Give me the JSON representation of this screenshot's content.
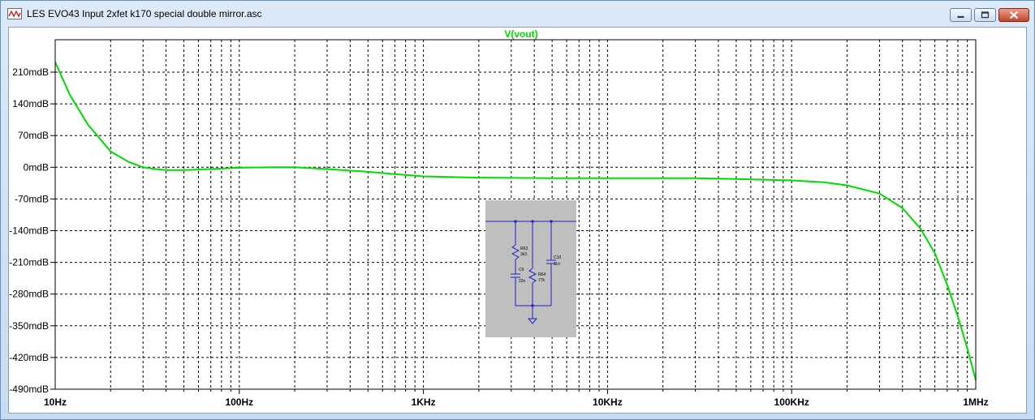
{
  "window": {
    "title": "LES EVO43 Input 2xfet k170 special double mirror.asc",
    "icon": "ltspice-waveform-icon",
    "controls": [
      "minimize-icon",
      "maximize-icon",
      "close-icon"
    ]
  },
  "chart_data": {
    "type": "line",
    "title": "V(vout)",
    "xlabel": "",
    "ylabel": "",
    "x_scale": "log",
    "xlim": [
      10,
      1000000
    ],
    "ylim": [
      -490,
      210
    ],
    "grid": true,
    "x_ticks": [
      {
        "value": 10,
        "label": "10Hz"
      },
      {
        "value": 100,
        "label": "100Hz"
      },
      {
        "value": 1000,
        "label": "1KHz"
      },
      {
        "value": 10000,
        "label": "10KHz"
      },
      {
        "value": 100000,
        "label": "100KHz"
      },
      {
        "value": 1000000,
        "label": "1MHz"
      }
    ],
    "y_ticks": [
      {
        "value": 210,
        "label": "210mdB"
      },
      {
        "value": 140,
        "label": "140mdB"
      },
      {
        "value": 70,
        "label": "70mdB"
      },
      {
        "value": 0,
        "label": "0mdB"
      },
      {
        "value": -70,
        "label": "-70mdB"
      },
      {
        "value": -140,
        "label": "-140mdB"
      },
      {
        "value": -210,
        "label": "-210mdB"
      },
      {
        "value": -280,
        "label": "-280mdB"
      },
      {
        "value": -350,
        "label": "-350mdB"
      },
      {
        "value": -420,
        "label": "-420mdB"
      },
      {
        "value": -490,
        "label": "-490mdB"
      }
    ],
    "series": [
      {
        "name": "V(vout)",
        "color": "#00dd00",
        "points": [
          [
            10,
            232
          ],
          [
            12,
            160
          ],
          [
            15,
            95
          ],
          [
            20,
            35
          ],
          [
            25,
            12
          ],
          [
            30,
            0
          ],
          [
            35,
            -4
          ],
          [
            40,
            -6
          ],
          [
            50,
            -6
          ],
          [
            60,
            -5
          ],
          [
            70,
            -4
          ],
          [
            100,
            -1
          ],
          [
            150,
            0
          ],
          [
            200,
            0
          ],
          [
            300,
            -4
          ],
          [
            500,
            -10
          ],
          [
            700,
            -15
          ],
          [
            1000,
            -20
          ],
          [
            2000,
            -23
          ],
          [
            5000,
            -24
          ],
          [
            10000,
            -24
          ],
          [
            20000,
            -24
          ],
          [
            30000,
            -24
          ],
          [
            50000,
            -26
          ],
          [
            100000,
            -29
          ],
          [
            150000,
            -33
          ],
          [
            200000,
            -40
          ],
          [
            300000,
            -58
          ],
          [
            400000,
            -90
          ],
          [
            500000,
            -135
          ],
          [
            600000,
            -190
          ],
          [
            700000,
            -260
          ],
          [
            800000,
            -330
          ],
          [
            900000,
            -400
          ],
          [
            1000000,
            -470
          ]
        ]
      }
    ]
  },
  "inset": {
    "components": [
      {
        "ref": "R63",
        "value": "3k3"
      },
      {
        "ref": "C9",
        "value": "22n"
      },
      {
        "ref": "R64",
        "value": "77k"
      },
      {
        "ref": "C10",
        "value": "11n"
      }
    ]
  },
  "colors": {
    "plot_background": "#ffffff",
    "grid": "#000000",
    "trace": "#00dd00",
    "inset_background": "#c0c0c0",
    "inset_wire": "#2020c0"
  }
}
